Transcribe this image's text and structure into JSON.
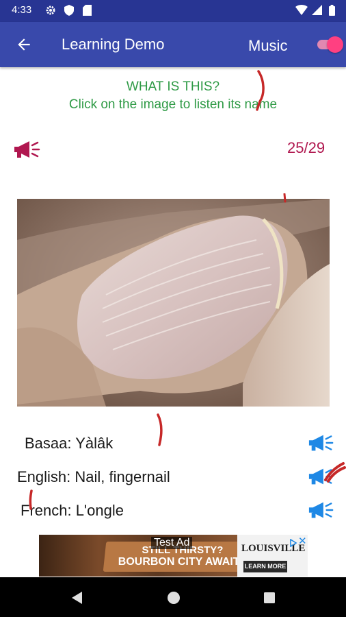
{
  "status_bar": {
    "time": "4:33",
    "icons": [
      "settings-icon",
      "shield-icon",
      "sd-card-icon",
      "wifi-icon",
      "signal-icon",
      "battery-icon"
    ]
  },
  "app_bar": {
    "title": "Learning Demo",
    "music_label": "Music",
    "music_toggle_on": true,
    "colors": {
      "status": "#283593",
      "toolbar": "#3949ab",
      "accent": "#ff4081"
    }
  },
  "prompt": {
    "line1": "WHAT IS THIS?",
    "line2": "Click on the image to listen its name",
    "color": "#2e9a45"
  },
  "counter": "25/29",
  "image": {
    "subject": "fingernail photo"
  },
  "translations": [
    {
      "text": "Basaa: Yàlâk",
      "speaker": "megaphone-icon"
    },
    {
      "text": "English: Nail, fingernail",
      "speaker": "megaphone-icon"
    },
    {
      "text": "French: L'ongle",
      "speaker": "megaphone-icon"
    }
  ],
  "ad": {
    "test_label": "Test Ad",
    "headline1": "STILL THIRSTY?",
    "headline2": "BOURBON CITY AWAITS",
    "brand": "LOUISVILLE",
    "cta": "LEARN MORE",
    "close": "✕"
  },
  "nav_bar": {
    "icons": [
      "back-triangle-icon",
      "home-circle-icon",
      "recents-square-icon"
    ]
  }
}
